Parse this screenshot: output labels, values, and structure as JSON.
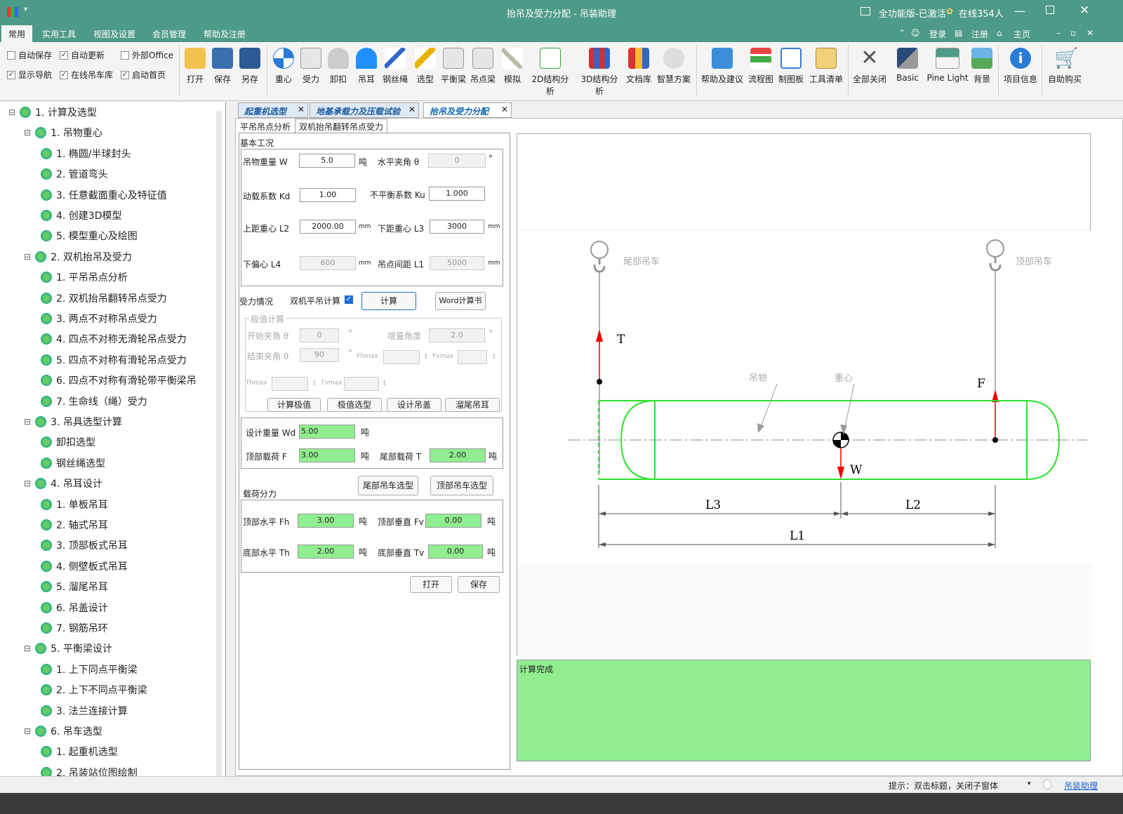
{
  "window": {
    "title": "抬吊及受力分配 - 吊装助理",
    "edition": "全功能版-已激活",
    "online": "在线354人"
  },
  "menu_tabs": [
    "常用",
    "实用工具",
    "视图及设置",
    "会员管理",
    "帮助及注册"
  ],
  "account_links": {
    "login": "登录",
    "register": "注册",
    "home": "主页"
  },
  "options": [
    {
      "label": "自动保存",
      "checked": false
    },
    {
      "label": "自动更新",
      "checked": true
    },
    {
      "label": "外部Office",
      "checked": false
    },
    {
      "label": "显示导航",
      "checked": true
    },
    {
      "label": "在线吊车库",
      "checked": true
    },
    {
      "label": "启动首页",
      "checked": true
    }
  ],
  "ribbon_buttons": [
    "打开",
    "保存",
    "另存",
    "重心",
    "受力",
    "卸扣",
    "吊耳",
    "钢丝绳",
    "选型",
    "平衡梁",
    "吊点梁",
    "模拟",
    "2D结构分析",
    "3D结构分析",
    "文档库",
    "智慧方案",
    "帮助及建议",
    "流程图",
    "制图板",
    "工具清单",
    "全部关闭",
    "Basic",
    "Pine Light",
    "背景",
    "项目信息",
    "自助购买"
  ],
  "tree": [
    {
      "level": 0,
      "label": "1. 计算及选型"
    },
    {
      "level": 1,
      "label": "1. 吊物重心"
    },
    {
      "level": 2,
      "label": "1. 椭圆/半球封头"
    },
    {
      "level": 2,
      "label": "2. 管道弯头"
    },
    {
      "level": 2,
      "label": "3. 任意截面重心及特征值"
    },
    {
      "level": 2,
      "label": "4. 创建3D模型"
    },
    {
      "level": 2,
      "label": "5. 模型重心及绘图"
    },
    {
      "level": 1,
      "label": "2. 双机抬吊及受力"
    },
    {
      "level": 2,
      "label": "1. 平吊吊点分析"
    },
    {
      "level": 2,
      "label": "2. 双机抬吊翻转吊点受力"
    },
    {
      "level": 2,
      "label": "3. 两点不对称吊点受力"
    },
    {
      "level": 2,
      "label": "4. 四点不对称无滑轮吊点受力"
    },
    {
      "level": 2,
      "label": "5. 四点不对称有滑轮吊点受力"
    },
    {
      "level": 2,
      "label": "6. 四点不对称有滑轮带平衡梁吊"
    },
    {
      "level": 2,
      "label": "7. 生命线（绳）受力"
    },
    {
      "level": 1,
      "label": "3. 吊具选型计算"
    },
    {
      "level": 2,
      "label": "卸扣选型"
    },
    {
      "level": 2,
      "label": "钢丝绳选型"
    },
    {
      "level": 1,
      "label": "4. 吊耳设计"
    },
    {
      "level": 2,
      "label": "1. 单板吊耳"
    },
    {
      "level": 2,
      "label": "2. 轴式吊耳"
    },
    {
      "level": 2,
      "label": "3. 顶部板式吊耳"
    },
    {
      "level": 2,
      "label": "4. 侧壁板式吊耳"
    },
    {
      "level": 2,
      "label": "5. 溜尾吊耳"
    },
    {
      "level": 2,
      "label": "6. 吊盖设计"
    },
    {
      "level": 2,
      "label": "7. 钢筋吊环"
    },
    {
      "level": 1,
      "label": "5. 平衡梁设计"
    },
    {
      "level": 2,
      "label": "1. 上下同点平衡梁"
    },
    {
      "level": 2,
      "label": "2. 上下不同点平衡梁"
    },
    {
      "level": 2,
      "label": "3. 法兰连接计算"
    },
    {
      "level": 1,
      "label": "6. 吊车选型"
    },
    {
      "level": 2,
      "label": "1. 起重机选型"
    },
    {
      "level": 2,
      "label": "2. 吊装站位图绘制"
    }
  ],
  "doc_tabs": [
    "起重机选型",
    "地基承载力及压载试验",
    "抬吊及受力分配"
  ],
  "sub_tabs": [
    "平吊吊点分析",
    "双机抬吊翻转吊点受力"
  ],
  "form": {
    "basic_title": "基本工况",
    "weight_label": "吊物重量 W",
    "weight": "5.0",
    "weight_unit": "吨",
    "angle_label": "水平夹角 θ",
    "angle": "0",
    "angle_unit": "°",
    "kd_label": "动载系数 Kd",
    "kd": "1.00",
    "ku_label": "不平衡系数 Ku",
    "ku": "1.000",
    "l2_label": "上距重心 L2",
    "l2": "2000.00",
    "mm": "mm",
    "l3_label": "下距重心 L3",
    "l3": "3000",
    "l4_label": "下偏心 L4",
    "l4": "600",
    "l1_label": "吊点间距 L1",
    "l1": "5000",
    "force_title": "受力情况",
    "flat_calc_label": "双机平吊计算",
    "calc_button": "计算",
    "word_button": "Word计算书",
    "extreme_title": "极值计算",
    "start_angle_label": "开始夹角 θ",
    "start_angle": "0",
    "step_label": "增量角度",
    "step": "2.0",
    "end_angle_label": "结束夹角 θ",
    "end_angle": "90",
    "fhmax": "Fhmax",
    "fvmax": "Fvmax",
    "thmax": "Thmax",
    "tvmax": "Tvmax",
    "t": "t",
    "extreme_buttons": [
      "计算极值",
      "极值选型",
      "设计吊盖",
      "溜尾吊耳"
    ],
    "wd_label": "设计重量 Wd",
    "wd": "5.00",
    "f_label": "顶部载荷 F",
    "f": "3.00",
    "t_label": "尾部载荷 T",
    "t_val": "2.00",
    "ton": "吨",
    "split_title": "载荷分力",
    "tail_crane_button": "尾部吊车选型",
    "top_crane_button": "顶部吊车选型",
    "fh_label": "顶部水平 Fh",
    "fh": "3.00",
    "fv_label": "顶部垂直 Fv",
    "fv": "0.00",
    "th_label": "底部水平 Th",
    "th": "2.00",
    "tv_label": "底部垂直 Tv",
    "tv": "0.00",
    "open_button": "打开",
    "save_button": "保存"
  },
  "diagram": {
    "tail_crane": "尾部吊车",
    "top_crane": "顶部吊车",
    "T": "T",
    "F": "F",
    "W": "W",
    "object": "吊物",
    "cog": "重心",
    "L1": "L1",
    "L2": "L2",
    "L3": "L3"
  },
  "result_text": "计算完成",
  "status": {
    "hint": "提示：双击标题，关闭子窗体",
    "link": "吊装助理"
  }
}
